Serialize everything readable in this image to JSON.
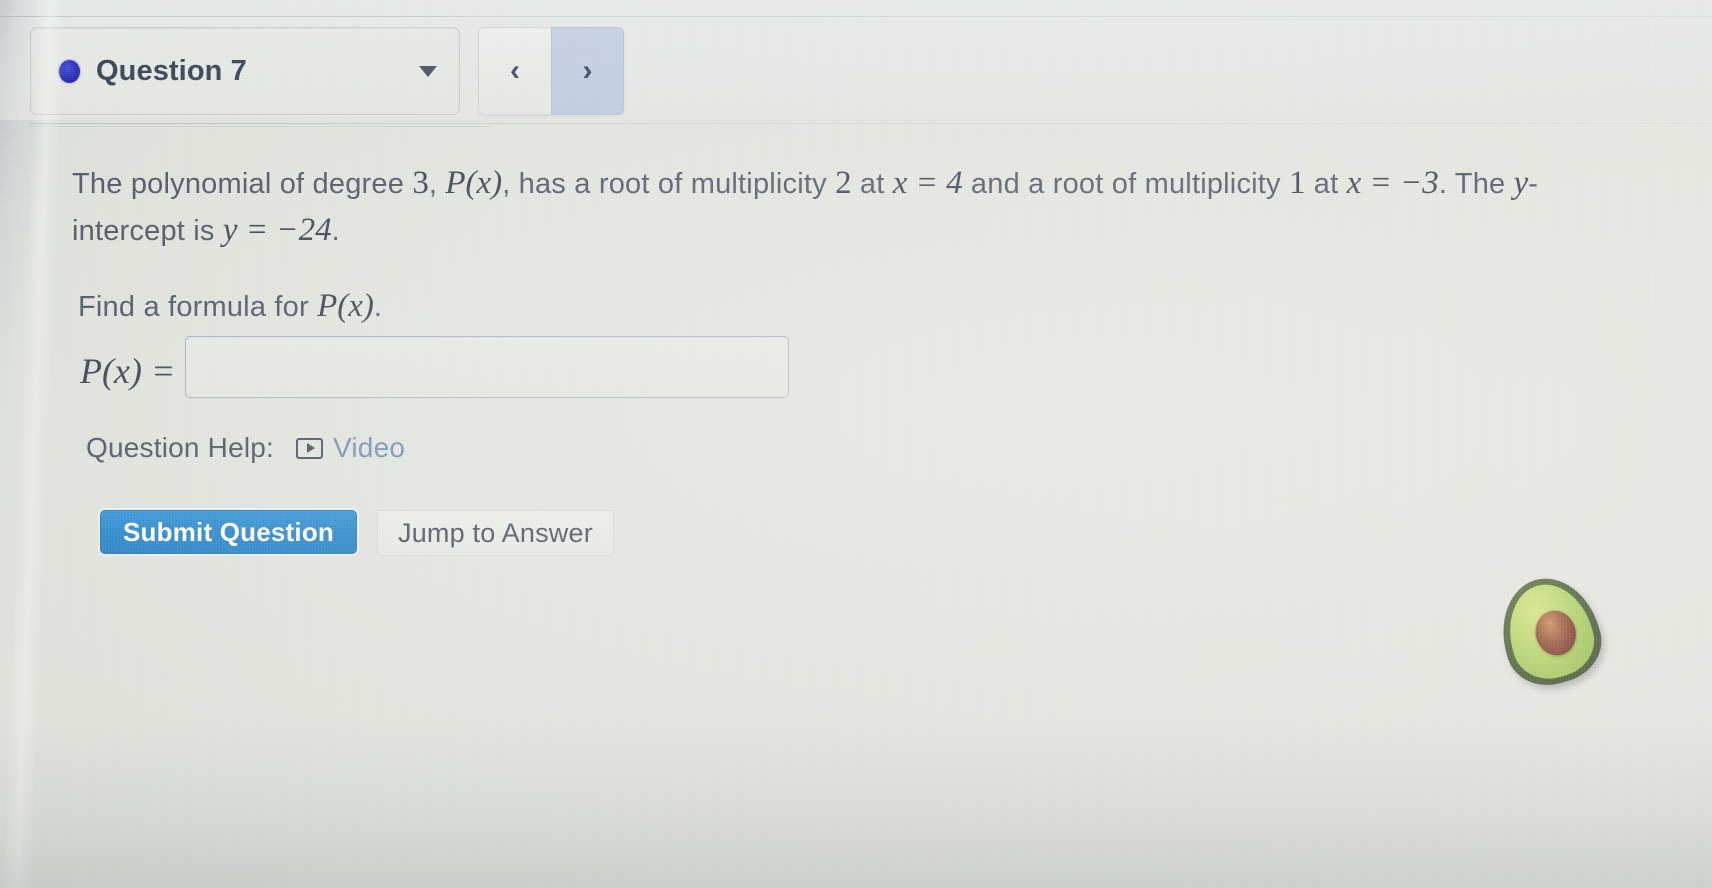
{
  "window": {
    "app": "online-math-homework",
    "background_color": "#e2e4dd"
  },
  "toolbar": {
    "question_selector": {
      "label": "Question 7",
      "status_dot_color": "#1f1fb4",
      "caret_icon": "chevron-down-icon"
    },
    "prev_button": {
      "label": "‹",
      "icon": "chevron-left-icon"
    },
    "next_button": {
      "label": "›",
      "icon": "chevron-right-icon",
      "active_color": "#c3cfe4"
    }
  },
  "question": {
    "statement": {
      "seg1": "The polynomial of degree ",
      "degree": "3",
      "seg2": ", ",
      "poly": "P(x)",
      "seg3": ", has a root of multiplicity ",
      "mult1": "2",
      "seg4": " at ",
      "root1": "x = 4",
      "seg5": " and a root of multiplicity ",
      "mult2": "1",
      "seg6": " at ",
      "root2": "x = −3",
      "seg7": ". The ",
      "yvar": "y",
      "seg8": "-intercept is ",
      "yint": "y = −24",
      "seg9": "."
    },
    "prompt": {
      "text_before": "Find a formula for ",
      "math": "P(x)",
      "text_after": "."
    },
    "answer": {
      "lhs": "P(x) =",
      "value": "",
      "placeholder": ""
    }
  },
  "help": {
    "label": "Question Help:",
    "video_icon": "video-play-icon",
    "video_link": "Video"
  },
  "actions": {
    "submit_label": "Submit Question",
    "submit_color": "#1d81c9",
    "jump_label": "Jump to Answer"
  },
  "decoration": {
    "emoji": "avocado"
  }
}
